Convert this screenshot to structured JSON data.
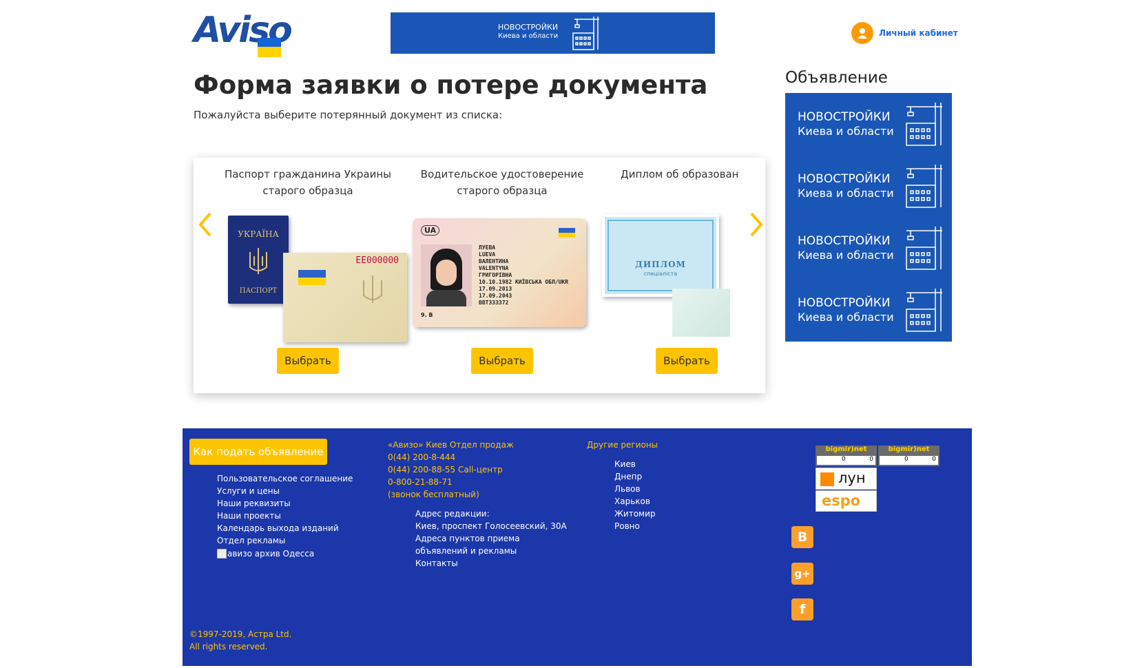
{
  "header": {
    "logo_text": "Aviso",
    "banner": {
      "line1": "НОВОСТРОЙКИ",
      "line2": "Киева и области"
    },
    "cabinet_label": "Личный кабинет"
  },
  "main": {
    "title": "Форма заявки о потере документа",
    "subtitle": "Пожалуйста выберите потерянный документ из списка:",
    "documents": [
      {
        "title_line1": "Паспорт гражданина Украины",
        "title_line2": "старого образца",
        "button": "Выбрать"
      },
      {
        "title_line1": "Водительское удостоверение",
        "title_line2": "старого образца",
        "button": "Выбрать"
      },
      {
        "title_line1": "Диплом об образован",
        "title_line2": "",
        "button": "Выбрать"
      }
    ],
    "passport_pic": {
      "cover": "УКРАЇНА",
      "cover_bottom": "ПАСПОРТ",
      "number": "ЕЕ000000"
    },
    "license_pic": {
      "country": "UA",
      "name1": "ЛУЕВА",
      "name2": "LUEVA",
      "name3": "ВАЛЕНТИНА",
      "name4": "VALENTYNA",
      "name5": "ГРИГОРІВНА",
      "dob": "10.10.1982 КИЇВСЬКА ОБЛ/UKR",
      "d1": "17.09.2013",
      "d2": "17.09.2043",
      "num": "BBT333372",
      "cat": "9. B"
    },
    "diploma_pic": {
      "title": "ДИПЛОМ",
      "sub": "спеціаліста"
    }
  },
  "sidebar": {
    "title": "Объявление",
    "ads": [
      {
        "line1": "НОВОСТРОЙКИ",
        "line2": "Киева и области"
      },
      {
        "line1": "НОВОСТРОЙКИ",
        "line2": "Киева и области"
      },
      {
        "line1": "НОВОСТРОЙКИ",
        "line2": "Киева и области"
      },
      {
        "line1": "НОВОСТРОЙКИ",
        "line2": "Киева и области"
      }
    ]
  },
  "footer": {
    "how_button": "Как подать объявление",
    "links": [
      "Пользовательское соглашение",
      "Услуги и цены",
      "Наши реквизиты",
      "Наши проекты",
      "Календарь выхода изданий",
      "Отдел рекламы"
    ],
    "archive_img_alt": "авизо архив Одесса",
    "sales_title": "«Авизо» Киев Отдел продаж",
    "phones": [
      "0(44) 200-8-444",
      "0(44) 200-88-55 Call-центр",
      "0-800-21-88-71",
      "(звонок бесплатный)"
    ],
    "address_title": "Адрес редакции:",
    "address": "Киев, проспект Голосеевский, 30А",
    "points_line1": "Адреса пунктов приема",
    "points_line2": "объявлений и рекламы",
    "contacts": "Контакты",
    "regions_title": "Другие регионы",
    "regions": [
      "Киев",
      "Днепр",
      "Львов",
      "Харьков",
      "Житомир",
      "Ровно"
    ],
    "counter_label": "bigmir)net",
    "counter_values": [
      "0",
      "0",
      "0",
      "0"
    ],
    "lun_label": "лун",
    "espo_label": "espo",
    "social": [
      "В",
      "g+",
      "f"
    ],
    "copyright": "©1997-2019, Астра Ltd.",
    "rights": "All rights reserved."
  },
  "colors": {
    "brand_blue": "#1a56b5",
    "footer_blue": "#1c37a9",
    "accent_yellow": "#ffc400",
    "orange": "#ff9a00"
  }
}
